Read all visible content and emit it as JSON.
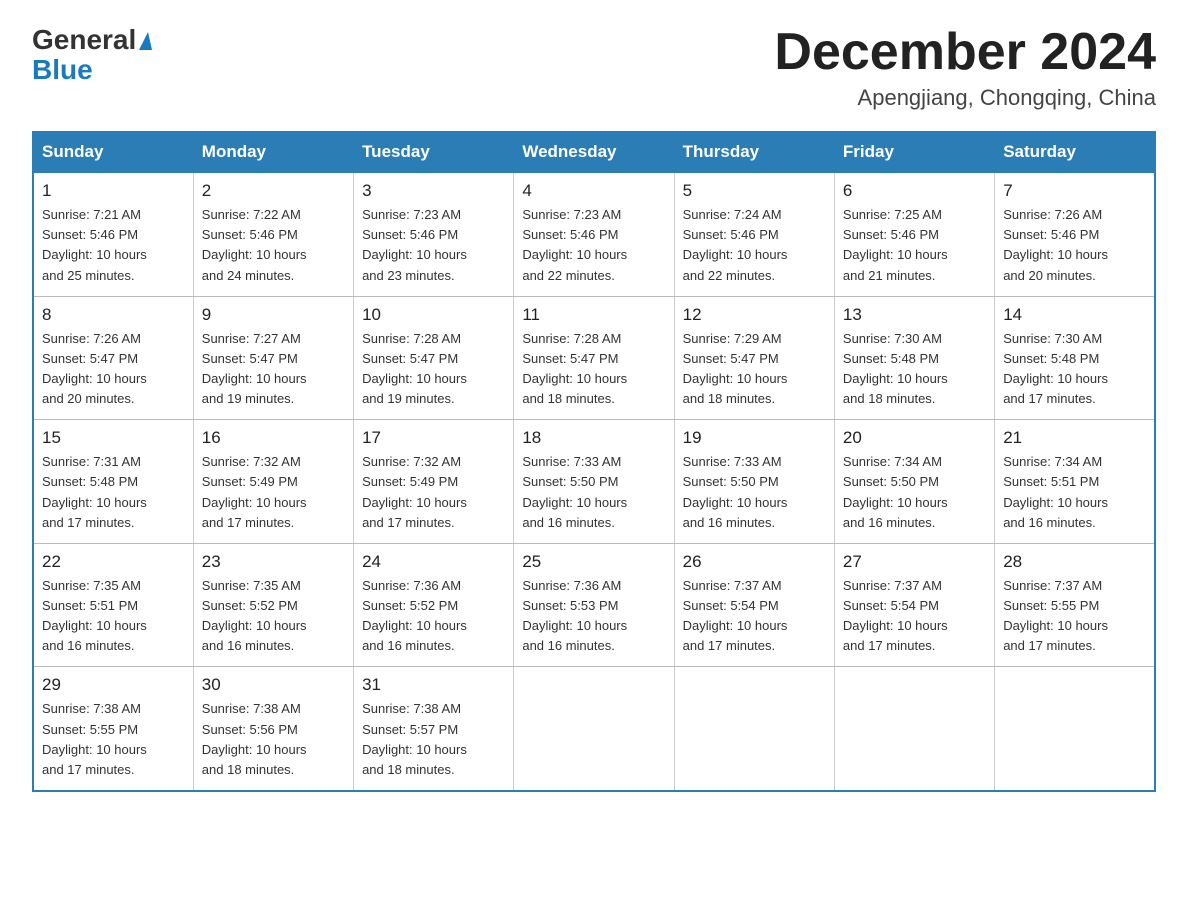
{
  "header": {
    "logo_general": "General",
    "logo_blue": "Blue",
    "title": "December 2024",
    "subtitle": "Apengjiang, Chongqing, China"
  },
  "weekdays": [
    "Sunday",
    "Monday",
    "Tuesday",
    "Wednesday",
    "Thursday",
    "Friday",
    "Saturday"
  ],
  "weeks": [
    [
      {
        "day": "1",
        "sunrise": "7:21 AM",
        "sunset": "5:46 PM",
        "daylight": "10 hours and 25 minutes."
      },
      {
        "day": "2",
        "sunrise": "7:22 AM",
        "sunset": "5:46 PM",
        "daylight": "10 hours and 24 minutes."
      },
      {
        "day": "3",
        "sunrise": "7:23 AM",
        "sunset": "5:46 PM",
        "daylight": "10 hours and 23 minutes."
      },
      {
        "day": "4",
        "sunrise": "7:23 AM",
        "sunset": "5:46 PM",
        "daylight": "10 hours and 22 minutes."
      },
      {
        "day": "5",
        "sunrise": "7:24 AM",
        "sunset": "5:46 PM",
        "daylight": "10 hours and 22 minutes."
      },
      {
        "day": "6",
        "sunrise": "7:25 AM",
        "sunset": "5:46 PM",
        "daylight": "10 hours and 21 minutes."
      },
      {
        "day": "7",
        "sunrise": "7:26 AM",
        "sunset": "5:46 PM",
        "daylight": "10 hours and 20 minutes."
      }
    ],
    [
      {
        "day": "8",
        "sunrise": "7:26 AM",
        "sunset": "5:47 PM",
        "daylight": "10 hours and 20 minutes."
      },
      {
        "day": "9",
        "sunrise": "7:27 AM",
        "sunset": "5:47 PM",
        "daylight": "10 hours and 19 minutes."
      },
      {
        "day": "10",
        "sunrise": "7:28 AM",
        "sunset": "5:47 PM",
        "daylight": "10 hours and 19 minutes."
      },
      {
        "day": "11",
        "sunrise": "7:28 AM",
        "sunset": "5:47 PM",
        "daylight": "10 hours and 18 minutes."
      },
      {
        "day": "12",
        "sunrise": "7:29 AM",
        "sunset": "5:47 PM",
        "daylight": "10 hours and 18 minutes."
      },
      {
        "day": "13",
        "sunrise": "7:30 AM",
        "sunset": "5:48 PM",
        "daylight": "10 hours and 18 minutes."
      },
      {
        "day": "14",
        "sunrise": "7:30 AM",
        "sunset": "5:48 PM",
        "daylight": "10 hours and 17 minutes."
      }
    ],
    [
      {
        "day": "15",
        "sunrise": "7:31 AM",
        "sunset": "5:48 PM",
        "daylight": "10 hours and 17 minutes."
      },
      {
        "day": "16",
        "sunrise": "7:32 AM",
        "sunset": "5:49 PM",
        "daylight": "10 hours and 17 minutes."
      },
      {
        "day": "17",
        "sunrise": "7:32 AM",
        "sunset": "5:49 PM",
        "daylight": "10 hours and 17 minutes."
      },
      {
        "day": "18",
        "sunrise": "7:33 AM",
        "sunset": "5:50 PM",
        "daylight": "10 hours and 16 minutes."
      },
      {
        "day": "19",
        "sunrise": "7:33 AM",
        "sunset": "5:50 PM",
        "daylight": "10 hours and 16 minutes."
      },
      {
        "day": "20",
        "sunrise": "7:34 AM",
        "sunset": "5:50 PM",
        "daylight": "10 hours and 16 minutes."
      },
      {
        "day": "21",
        "sunrise": "7:34 AM",
        "sunset": "5:51 PM",
        "daylight": "10 hours and 16 minutes."
      }
    ],
    [
      {
        "day": "22",
        "sunrise": "7:35 AM",
        "sunset": "5:51 PM",
        "daylight": "10 hours and 16 minutes."
      },
      {
        "day": "23",
        "sunrise": "7:35 AM",
        "sunset": "5:52 PM",
        "daylight": "10 hours and 16 minutes."
      },
      {
        "day": "24",
        "sunrise": "7:36 AM",
        "sunset": "5:52 PM",
        "daylight": "10 hours and 16 minutes."
      },
      {
        "day": "25",
        "sunrise": "7:36 AM",
        "sunset": "5:53 PM",
        "daylight": "10 hours and 16 minutes."
      },
      {
        "day": "26",
        "sunrise": "7:37 AM",
        "sunset": "5:54 PM",
        "daylight": "10 hours and 17 minutes."
      },
      {
        "day": "27",
        "sunrise": "7:37 AM",
        "sunset": "5:54 PM",
        "daylight": "10 hours and 17 minutes."
      },
      {
        "day": "28",
        "sunrise": "7:37 AM",
        "sunset": "5:55 PM",
        "daylight": "10 hours and 17 minutes."
      }
    ],
    [
      {
        "day": "29",
        "sunrise": "7:38 AM",
        "sunset": "5:55 PM",
        "daylight": "10 hours and 17 minutes."
      },
      {
        "day": "30",
        "sunrise": "7:38 AM",
        "sunset": "5:56 PM",
        "daylight": "10 hours and 18 minutes."
      },
      {
        "day": "31",
        "sunrise": "7:38 AM",
        "sunset": "5:57 PM",
        "daylight": "10 hours and 18 minutes."
      },
      null,
      null,
      null,
      null
    ]
  ],
  "labels": {
    "sunrise": "Sunrise:",
    "sunset": "Sunset:",
    "daylight": "Daylight:"
  }
}
